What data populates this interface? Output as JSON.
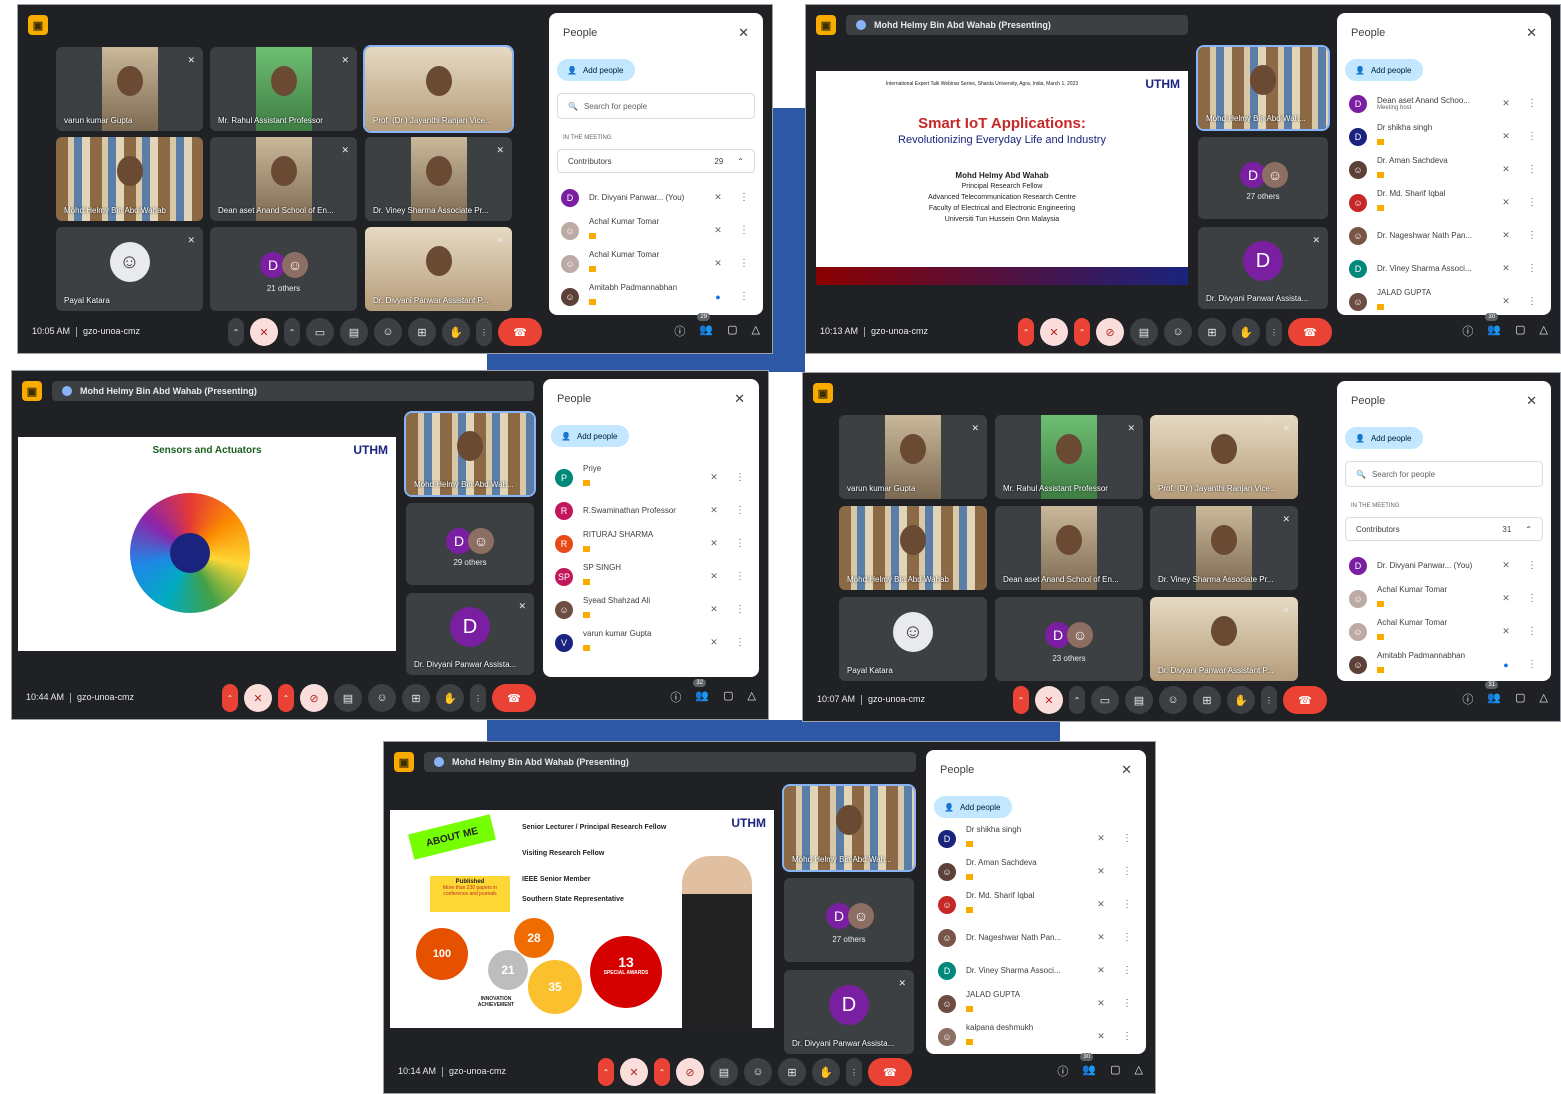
{
  "meeting_code": "gzo-unoa-cmz",
  "common": {
    "people_title": "People",
    "add_people": "Add people",
    "search_placeholder": "Search for people",
    "in_the_meeting": "IN THE MEETING",
    "contributors": "Contributors",
    "meeting_host": "Meeting host"
  },
  "shots": {
    "s1": {
      "time": "10:05 AM",
      "participants_count": "29",
      "contributors_count": "29",
      "tiles": [
        "varun kumar Gupta",
        "Mr. Rahul Assistant Professor",
        "Prof. (Dr.) Jayanthi Ranjan Vice...",
        "Mohd Helmy Bin Abd Wahab",
        "Dean aset Anand School of En...",
        "Dr. Viney Sharma Associate Pr...",
        "Payal Katara",
        "21 others",
        "Dr. Divyani Panwar Assistant P..."
      ],
      "people": [
        "Dr. Divyani Panwar... (You)",
        "Achal Kumar Tomar",
        "Achal Kumar Tomar",
        "Amitabh Padmannabhan"
      ]
    },
    "s2": {
      "time": "10:13 AM",
      "presenting": "Mohd Helmy Bin Abd Wahab (Presenting)",
      "participants_count": "30",
      "slide_header": "International Expert Talk Webinar Series, Sharda University, Agra, India, March 1, 2023",
      "slide_title": "Smart IoT Applications:",
      "slide_subtitle": "Revolutionizing Everyday Life and Industry",
      "slide_name": "Mohd Helmy Abd Wahab",
      "slide_role": "Principal Research Fellow",
      "slide_centre": "Advanced Telecommunication Research Centre",
      "slide_faculty": "Faculty of Electrical and Electronic Engineering",
      "slide_uni": "Universiti Tun Hussein Onn Malaysia",
      "uthm": "UTHM",
      "tiles": [
        "Mohd Helmy Bin Abd Wah...",
        "27 others",
        "Dr. Divyani Panwar Assista..."
      ],
      "people": [
        {
          "name": "Dean aset Anand Schoo...",
          "sub": "Meeting host"
        },
        {
          "name": "Dr shikha singh"
        },
        {
          "name": "Dr. Aman Sachdeva"
        },
        {
          "name": "Dr. Md. Sharif Iqbal"
        },
        {
          "name": "Dr. Nageshwar Nath Pan..."
        },
        {
          "name": "Dr. Viney Sharma Associ..."
        },
        {
          "name": "JALAD GUPTA"
        }
      ]
    },
    "s3": {
      "time": "10:44 AM",
      "presenting": "Mohd Helmy Bin Abd Wahab (Presenting)",
      "participants_count": "32",
      "slide_title": "Sensors and Actuators",
      "uthm": "UTHM",
      "tiles": [
        "Mohd Helmy Bin Abd Wah...",
        "29 others",
        "Dr. Divyani Panwar Assista..."
      ],
      "people": [
        "Priye",
        "R.Swaminathan Professor",
        "RITURAJ SHARMA",
        "SP SINGH",
        "Syead Shahzad Ali",
        "varun kumar Gupta"
      ]
    },
    "s4": {
      "time": "10:07 AM",
      "participants_count": "31",
      "contributors_count": "31",
      "tiles": [
        "varun kumar Gupta",
        "Mr. Rahul Assistant Professor",
        "Prof. (Dr.) Jayanthi Ranjan Vice...",
        "Mohd Helmy Bin Abd Wahab",
        "Dean aset Anand School of En...",
        "Dr. Viney Sharma Associate Pr...",
        "Payal Katara",
        "23 others",
        "Dr. Divyani Panwar Assistant P..."
      ],
      "people": [
        "Dr. Divyani Panwar... (You)",
        "Achal Kumar Tomar",
        "Achal Kumar Tomar",
        "Amitabh Padmannabhan"
      ]
    },
    "s5": {
      "time": "10:14 AM",
      "presenting": "Mohd Helmy Bin Abd Wahab (Presenting)",
      "participants_count": "30",
      "uthm": "UTHM",
      "about_me": "ABOUT ME",
      "slide_l1": "Senior Lecturer / Principal Research Fellow",
      "slide_l2": "Visiting Research Fellow",
      "slide_l3": "IEEE Senior Member",
      "slide_l4": "Southern State Representative",
      "published": "Published",
      "published_detail": "More than 230 papers in conference and journals",
      "g100": "100",
      "g28": "28",
      "g21": "21",
      "g35": "35",
      "g13": "13",
      "g13_label": "SPECIAL AWARDS",
      "innovation": "INNOVATION ACHIEVEMENT",
      "tiles": [
        "Mohd Helmy Bin Abd Wah...",
        "27 others",
        "Dr. Divyani Panwar Assista..."
      ],
      "people": [
        "Dr shikha singh",
        "Dr. Aman Sachdeva",
        "Dr. Md. Sharif Iqbal",
        "Dr. Nageshwar Nath Pan...",
        "Dr. Viney Sharma Associ...",
        "JALAD GUPTA",
        "kalpana deshmukh"
      ]
    }
  },
  "colors": {
    "accent": "#8ab4f8",
    "meet_bg": "#202124",
    "end_call": "#ea4335",
    "blue_connector": "#2e57a6"
  },
  "icons": [
    "meet-logo-icon",
    "mic-off-icon",
    "camera-icon",
    "captions-icon",
    "emoji-icon",
    "present-icon",
    "hand-icon",
    "more-icon",
    "end-call-icon",
    "info-icon",
    "people-icon",
    "chat-icon",
    "activities-icon",
    "close-icon",
    "add-person-icon",
    "search-icon",
    "chevron-up-icon"
  ]
}
